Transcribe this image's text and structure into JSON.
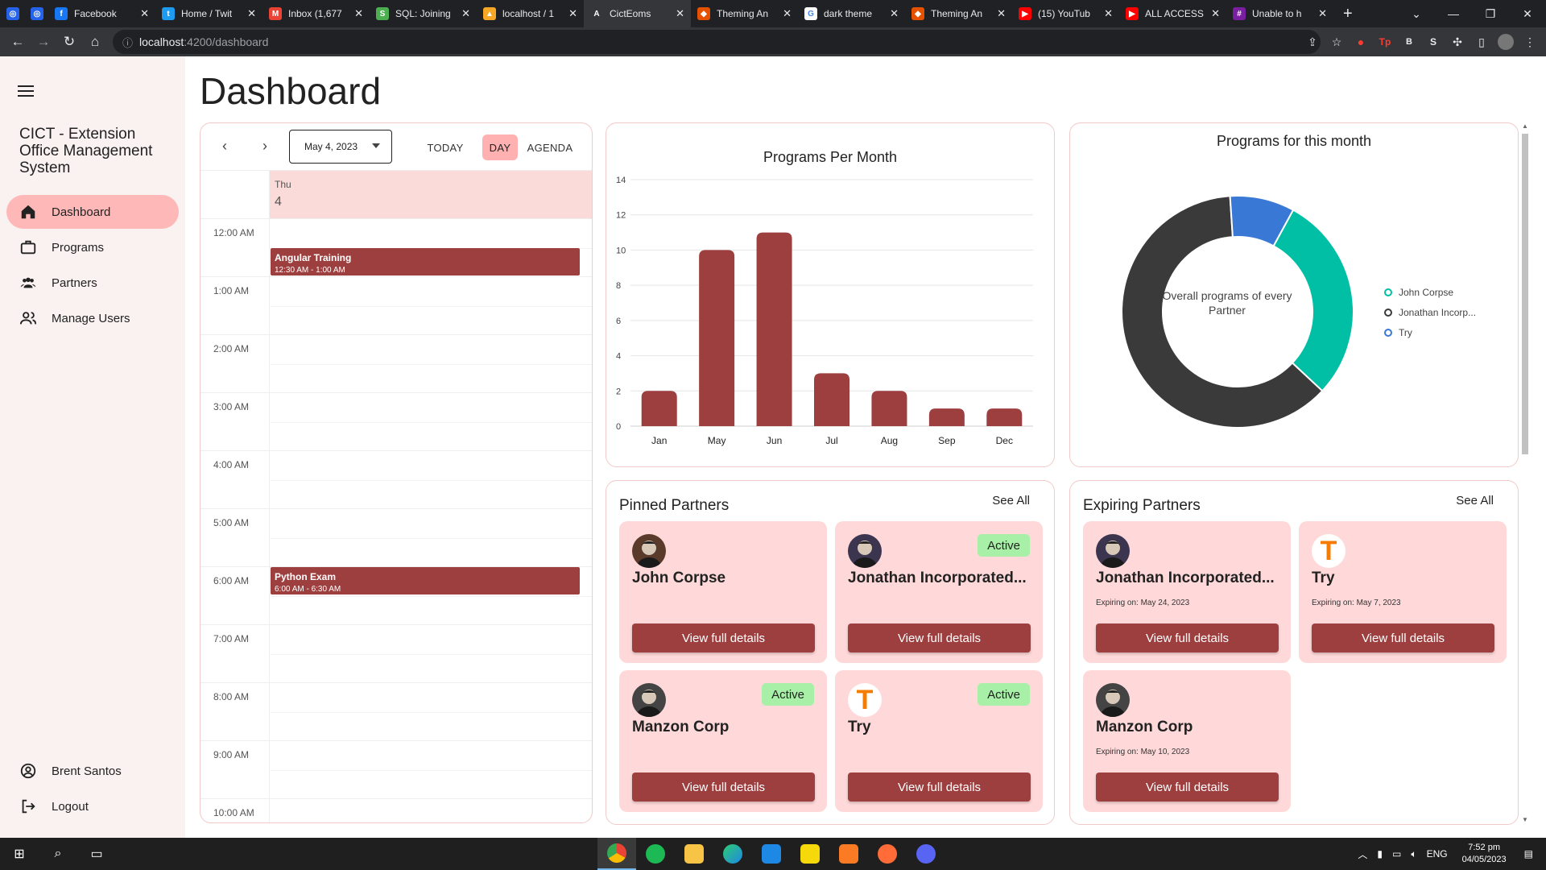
{
  "browser": {
    "tabs": [
      {
        "title": "",
        "fav_color": "#2563eb",
        "fav_char": "◎"
      },
      {
        "title": "",
        "fav_color": "#2563eb",
        "fav_char": "◎"
      },
      {
        "title": "Facebook",
        "fav_color": "#1877f2",
        "fav_char": "f"
      },
      {
        "title": "Home / Twit",
        "fav_color": "#1d9bf0",
        "fav_char": "t"
      },
      {
        "title": "Inbox (1,677",
        "fav_color": "#ea4335",
        "fav_char": "M"
      },
      {
        "title": "SQL: Joining",
        "fav_color": "#4caf50",
        "fav_char": "S"
      },
      {
        "title": "localhost / 1",
        "fav_color": "#f9a825",
        "fav_char": "▲"
      },
      {
        "title": "CictEoms",
        "fav_color": "#35363a",
        "fav_char": "A"
      },
      {
        "title": "Theming An",
        "fav_color": "#e65100",
        "fav_char": "◆"
      },
      {
        "title": "dark theme",
        "fav_color": "#ffffff",
        "fav_char": "G"
      },
      {
        "title": "Theming An",
        "fav_color": "#e65100",
        "fav_char": "◆"
      },
      {
        "title": "(15) YouTub",
        "fav_color": "#ff0000",
        "fav_char": "▶"
      },
      {
        "title": "ALL ACCESS",
        "fav_color": "#ff0000",
        "fav_char": "▶"
      },
      {
        "title": "Unable to h",
        "fav_color": "#7b1fa2",
        "fav_char": "#"
      }
    ],
    "active_tab": 7,
    "url_host": "localhost",
    "url_path": ":4200/dashboard"
  },
  "sidebar": {
    "app_title": "CICT - Extension Office Management System",
    "nav": [
      {
        "label": "Dashboard",
        "icon": "home-icon",
        "active": true
      },
      {
        "label": "Programs",
        "icon": "briefcase-icon",
        "active": false
      },
      {
        "label": "Partners",
        "icon": "people-icon",
        "active": false
      },
      {
        "label": "Manage Users",
        "icon": "users-icon",
        "active": false
      }
    ],
    "user_name": "Brent Santos",
    "logout_label": "Logout"
  },
  "page_title": "Dashboard",
  "calendar": {
    "date_value": "May 4, 2023",
    "today_label": "TODAY",
    "day_label": "DAY",
    "agenda_label": "AGENDA",
    "day_of_week": "Thu",
    "day_number": "4",
    "hours": [
      "12:00 AM",
      "1:00 AM",
      "2:00 AM",
      "3:00 AM",
      "4:00 AM",
      "5:00 AM",
      "6:00 AM",
      "7:00 AM",
      "8:00 AM",
      "9:00 AM",
      "10:00 AM"
    ],
    "events": [
      {
        "name": "Angular Training",
        "time": "12:30 AM - 1:00 AM",
        "start_hour": 0.5
      },
      {
        "name": "Python Exam",
        "time": "6:00 AM - 6:30 AM",
        "start_hour": 6.0
      }
    ]
  },
  "bar_chart_title": "Programs Per Month",
  "pie_chart_title": "Programs for this month",
  "donut_center_text": "Overall programs of every Partner",
  "chart_data": [
    {
      "type": "bar",
      "title": "Programs Per Month",
      "categories": [
        "Jan",
        "May",
        "Jun",
        "Jul",
        "Aug",
        "Sep",
        "Dec"
      ],
      "values": [
        2,
        10,
        11,
        3,
        2,
        1,
        1
      ],
      "ylim": [
        0,
        14
      ],
      "yticks": [
        0,
        2,
        4,
        6,
        8,
        10,
        12,
        14
      ],
      "xlabel": "",
      "ylabel": "",
      "grid": true,
      "color": "#9e3f3f"
    },
    {
      "type": "pie",
      "title": "Programs for this month",
      "donut": true,
      "labels": [
        "John Corpse",
        "Jonathan Incorp...",
        "Try"
      ],
      "values": [
        29,
        62,
        9
      ],
      "colors": [
        "#00bfa5",
        "#3a3a3a",
        "#3a78d6"
      ],
      "legend": "right"
    }
  ],
  "pinned": {
    "title": "Pinned Partners",
    "see_all": "See All",
    "items": [
      {
        "name": "John Corpse",
        "status": "",
        "button": "View full details",
        "avatar": "photo",
        "avatar_color": "#5a3a2a"
      },
      {
        "name": "Jonathan Incorporated...",
        "status": "Active",
        "button": "View full details",
        "avatar": "photo",
        "avatar_color": "#3b3550"
      },
      {
        "name": "Manzon Corp",
        "status": "Active",
        "button": "View full details",
        "avatar": "photo",
        "avatar_color": "#444444"
      },
      {
        "name": "Try",
        "status": "Active",
        "button": "View full details",
        "avatar": "letter",
        "avatar_letter": "T"
      }
    ]
  },
  "expiring": {
    "title": "Expiring Partners",
    "see_all": "See All",
    "items": [
      {
        "name": "Jonathan Incorporated...",
        "expiry": "Expiring on: May 24, 2023",
        "button": "View full details",
        "avatar": "photo",
        "avatar_color": "#3b3550"
      },
      {
        "name": "Try",
        "expiry": "Expiring on: May 7, 2023",
        "button": "View full details",
        "avatar": "letter",
        "avatar_letter": "T"
      },
      {
        "name": "Manzon Corp",
        "expiry": "Expiring on: May 10, 2023",
        "button": "View full details",
        "avatar": "photo",
        "avatar_color": "#444444"
      }
    ]
  },
  "taskbar": {
    "lang": "ENG",
    "time": "7:52 pm",
    "date": "04/05/2023"
  }
}
